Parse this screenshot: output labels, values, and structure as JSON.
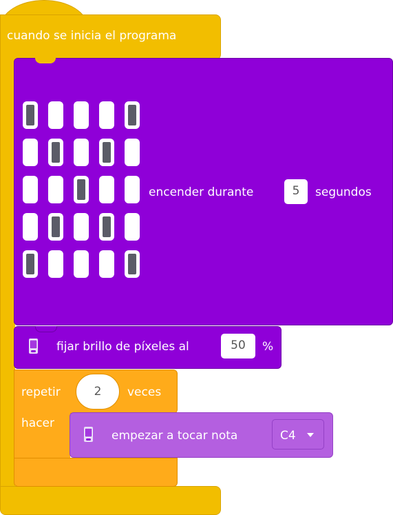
{
  "hat": {
    "label": "cuando se inicia el programa"
  },
  "led_block": {
    "matrix": [
      [
        1,
        0,
        0,
        0,
        1
      ],
      [
        0,
        1,
        0,
        1,
        0
      ],
      [
        0,
        0,
        1,
        0,
        0
      ],
      [
        0,
        1,
        0,
        1,
        0
      ],
      [
        1,
        0,
        0,
        0,
        1
      ]
    ],
    "label_before": "encender durante",
    "duration": "5",
    "label_after": "segundos"
  },
  "brightness_block": {
    "icon": "microbit-icon",
    "label": "fijar brillo de píxeles al",
    "value": "50",
    "unit": "%"
  },
  "loop_block": {
    "label_repeat": "repetir",
    "times": "2",
    "label_times": "veces",
    "label_do": "hacer"
  },
  "note_block": {
    "icon": "microbit-icon",
    "label": "empezar a tocar nota",
    "note": "C4",
    "dropdown_icon": "triangle-down-icon"
  },
  "colors": {
    "event": "#f2be00",
    "display": "#8f00d8",
    "loop": "#ffab1a",
    "sound": "#b45fe0"
  }
}
